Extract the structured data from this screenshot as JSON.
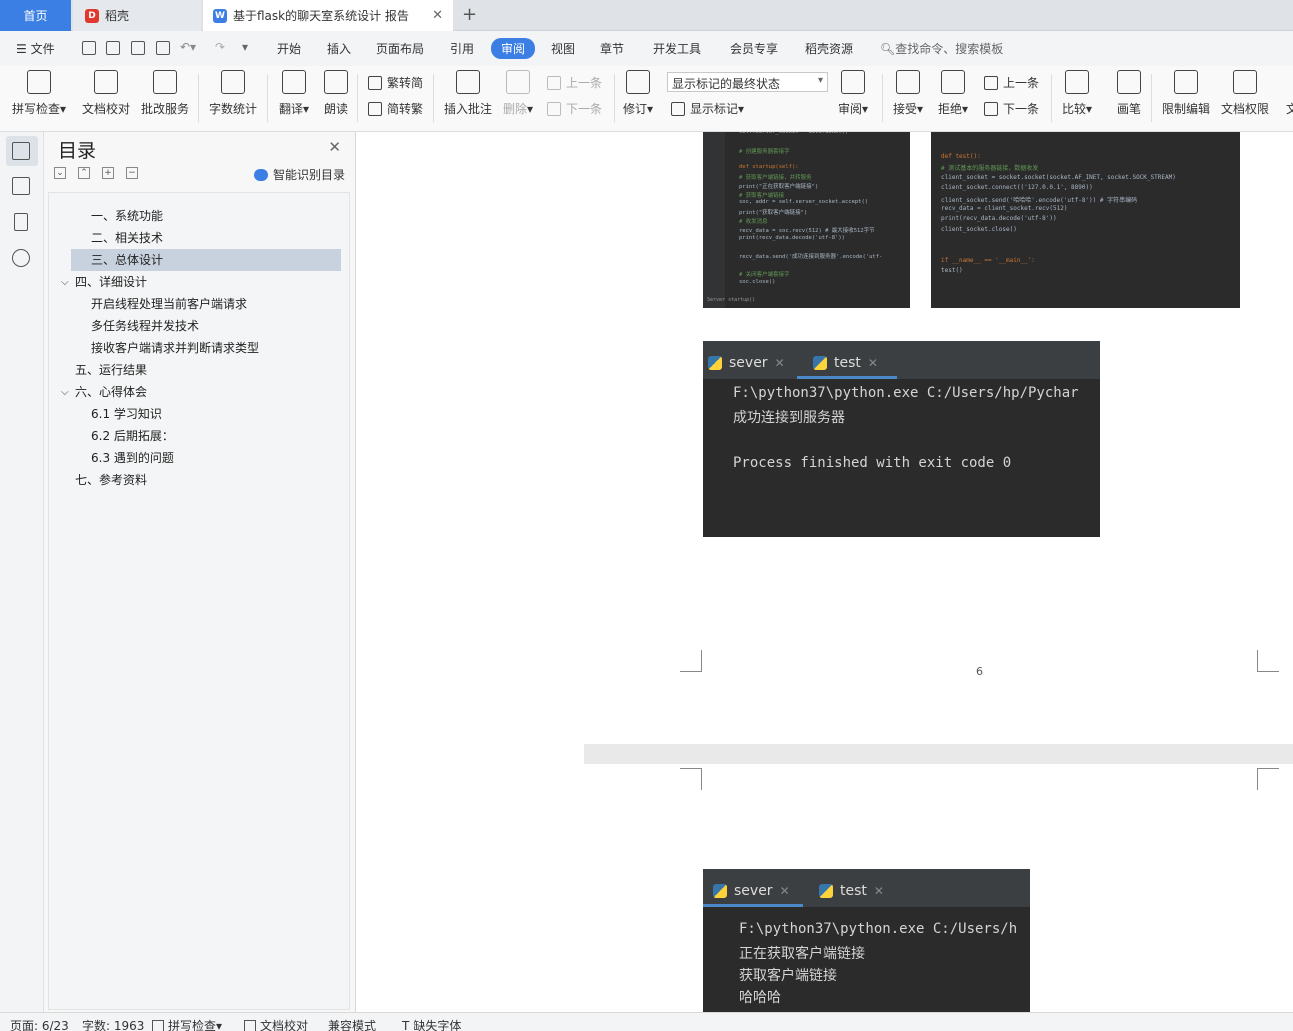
{
  "tabs": {
    "home": "首页",
    "daoke": "稻壳",
    "doc": "基于flask的聊天室系统设计 报告"
  },
  "menu": {
    "file": "文件",
    "items": [
      "开始",
      "插入",
      "页面布局",
      "引用",
      "审阅",
      "视图",
      "章节",
      "开发工具",
      "会员专享",
      "稻壳资源"
    ],
    "active": "审阅",
    "search": "查找命令、搜索模板"
  },
  "ribbon": {
    "spell_check": "拼写检查",
    "doc_proof": "文档校对",
    "batch_service": "批改服务",
    "word_count": "字数统计",
    "translate": "翻译",
    "read_aloud": "朗读",
    "trad_to_simp": "繁转简",
    "simp_to_trad": "简转繁",
    "insert_comment": "插入批注",
    "delete": "删除",
    "prev_comment": "上一条",
    "next_comment": "下一条",
    "track_changes": "修订",
    "markup_state": "显示标记的最终状态",
    "show_markup": "显示标记",
    "review": "审阅",
    "accept": "接受",
    "reject": "拒绝",
    "prev_change": "上一条",
    "next_change": "下一条",
    "compare": "比较",
    "pen": "画笔",
    "restrict_edit": "限制编辑",
    "doc_permission": "文档权限",
    "more": "文"
  },
  "toc": {
    "title": "目录",
    "smart": "智能识别目录",
    "items": [
      {
        "text": "一、系统功能",
        "level": 2
      },
      {
        "text": "二、相关技术",
        "level": 2
      },
      {
        "text": "三、总体设计",
        "level": 2,
        "selected": true
      },
      {
        "text": "四、详细设计",
        "level": 1,
        "expanded": true
      },
      {
        "text": "开启线程处理当前客户端请求",
        "level": 2
      },
      {
        "text": "多任务线程并发技术",
        "level": 2
      },
      {
        "text": "接收客户端请求并判断请求类型",
        "level": 2
      },
      {
        "text": "五、运行结果",
        "level": 1
      },
      {
        "text": "六、心得体会",
        "level": 1,
        "expanded": true
      },
      {
        "text": "6.1  学习知识",
        "level": 2
      },
      {
        "text": "6.2  后期拓展：",
        "level": 2
      },
      {
        "text": "6.3  遇到的问题",
        "level": 2
      },
      {
        "text": "七、参考资料",
        "level": 1
      }
    ]
  },
  "document": {
    "page_number": "6",
    "terminal1": {
      "tabs": [
        "sever",
        "test"
      ],
      "lines": [
        "F:\\python37\\python.exe C:/Users/hp/Pychar",
        "成功连接到服务器",
        "",
        "Process finished with exit code 0"
      ]
    },
    "terminal2": {
      "tabs": [
        "sever",
        "test"
      ],
      "lines": [
        "F:\\python37\\python.exe C:/Users/h",
        "正在获取客户端链接",
        "获取客户端链接",
        "哈哈哈"
      ]
    },
    "code_left": [
      "self.server_socket = SeverSoket()",
      "",
      "# 创建服务器套接字",
      "",
      "def startup(self):",
      "    # 获取客户端链接，并转服务",
      "    print(\"正在获取客户端链接\")",
      "    # 获取客户端链接",
      "    soc, addr = self.server_socket.accept()",
      "    print(\"获取客户端链接\")",
      "    # 收发消息",
      "    recv_data = soc.recv(512)  # 最大接收512字节",
      "    print(recv_data.decode('utf-8'))",
      "",
      "    recv_data.send('成功连接到服务器'.encode('utf-",
      "",
      "    # 关闭客户端套接字",
      "    soc.close()"
    ],
    "code_left_footer": "Server  startup()",
    "code_right": [
      "def test():",
      "    # 测试基本的服务器链接，数据收发",
      "    client_socket = socket.socket(socket.AF_INET, socket.SOCK_STREAM)",
      "    client_socket.connect(('127.0.0.1', 8890))",
      "    client_socket.send('哈哈哈'.encode('utf-8'))  # 字符串编码",
      "    recv_data = client_socket.recv(512)",
      "    print(recv_data.decode('utf-8'))",
      "    client_socket.close()",
      "",
      "",
      "if __name__ == '__main__':",
      "    test()"
    ]
  },
  "status": {
    "page": "页面: 6/23",
    "words": "字数: 1963",
    "spell": "拼写检查",
    "proof": "文档校对",
    "compat": "兼容模式",
    "missing_font": "缺失字体"
  },
  "colors": {
    "accent": "#3b7fe4",
    "code_bg": "#2b2b2b",
    "terminal_tab_bg": "#3c3f41"
  }
}
